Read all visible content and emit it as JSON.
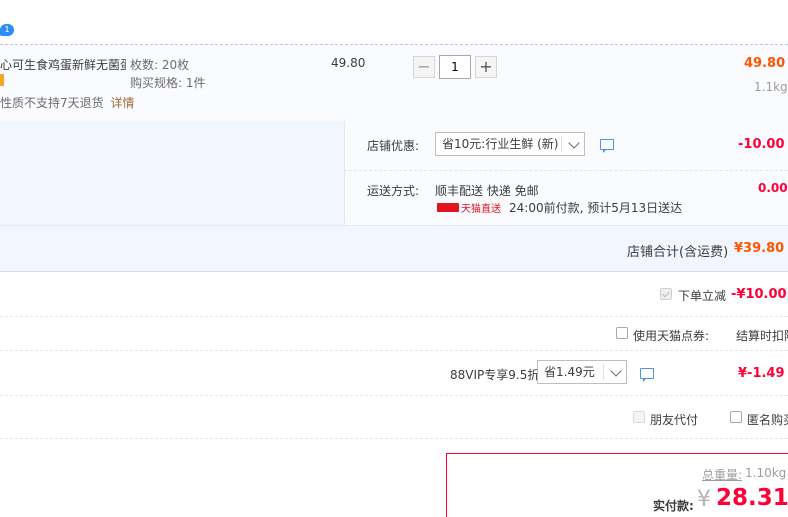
{
  "item": {
    "title": "心可生食鸡蛋新鲜无菌蛋...",
    "count_label": "枚数: 20枚",
    "spec_label": "购买规格: 1件",
    "service_note": "性质不支持7天退货",
    "detail_link": "详情",
    "unit_price": "49.80",
    "quantity": "1",
    "subtotal": "49.80",
    "weight": "1.1kg"
  },
  "shop": {
    "discount_label": "店铺优惠:",
    "discount_selected": "省10元:行业生鲜 (新)",
    "discount_amount": "-10.00",
    "shipping_label": "运送方式:",
    "shipping_method": "顺丰配送 快递 免邮",
    "tmall_direct": "天猫直送",
    "delivery_note": "24:00前付款, 预计5月13日送达",
    "shipping_amount": "0.00",
    "total_label": "店铺合计(含运费)",
    "total_value": "¥39.80"
  },
  "order": {
    "instant_discount_label": "下单立减",
    "instant_discount_value": "-¥10.00",
    "tmall_points_label": "使用天猫点券:",
    "tmall_points_value": "结算时扣除",
    "vip_label": "88VIP专享9.5折",
    "vip_selected": "省1.49元",
    "vip_value": "¥-1.49",
    "friend_pay_label": "朋友代付",
    "anonymous_label": "匿名购买"
  },
  "payment": {
    "weight_label": "总重量:",
    "weight_value": "1.10kg",
    "pay_label": "实付款:",
    "currency": "¥",
    "pay_value": "28.31"
  },
  "colors": {
    "price_red": "#ff0036",
    "orange": "#ff5500",
    "link_blue": "#4d96e6"
  }
}
